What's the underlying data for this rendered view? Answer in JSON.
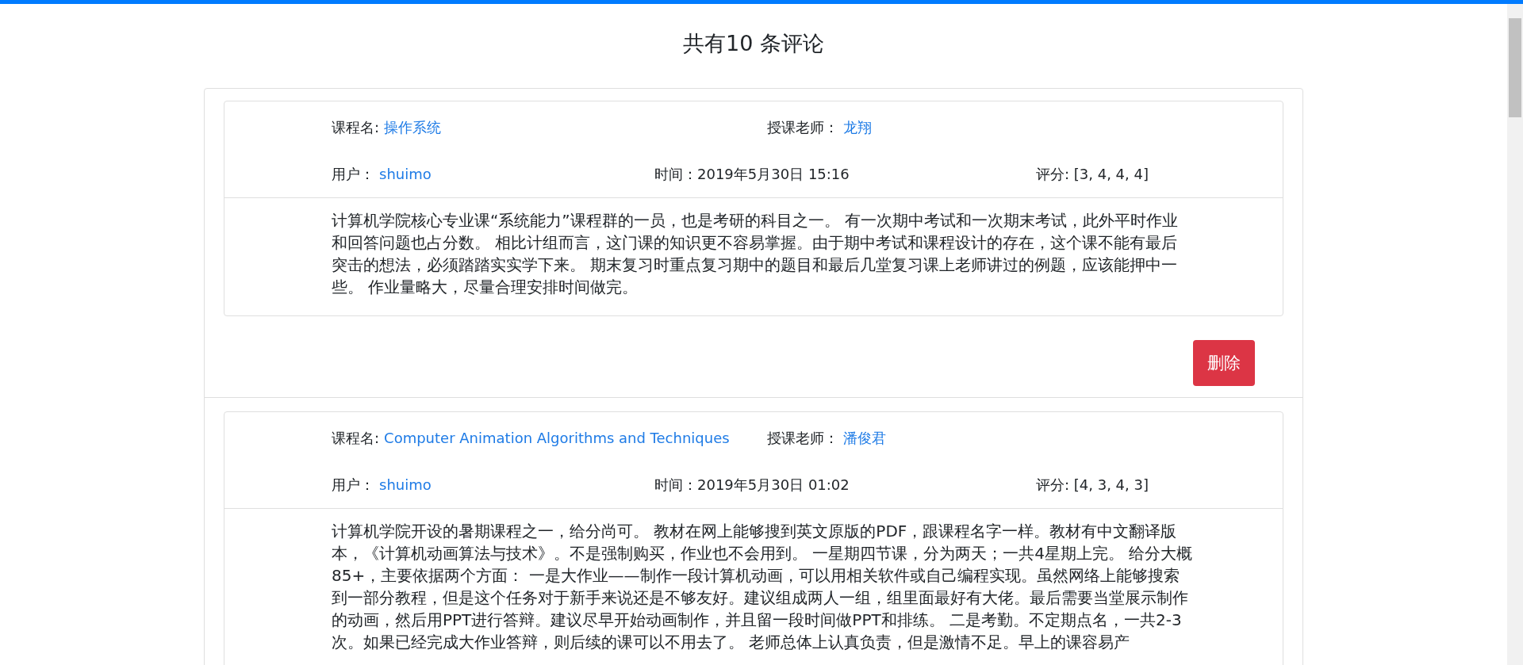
{
  "title": "共有10 条评论",
  "comments": [
    {
      "course_label": "课程名:",
      "course": "操作系统",
      "teacher_label": "授课老师：",
      "teacher": "龙翔",
      "user_label": "用户：",
      "user": "shuimo",
      "time": "时间：2019年5月30日 15:16",
      "score": "评分: [3, 4, 4, 4]",
      "body": "计算机学院核心专业课“系统能力”课程群的一员，也是考研的科目之一。 有一次期中考试和一次期末考试，此外平时作业和回答问题也占分数。 相比计组而言，这门课的知识更不容易掌握。由于期中考试和课程设计的存在，这个课不能有最后突击的想法，必须踏踏实实学下来。 期末复习时重点复习期中的题目和最后几堂复习课上老师讲过的例题，应该能押中一些。 作业量略大，尽量合理安排时间做完。",
      "delete_button": "删除"
    },
    {
      "course_label": "课程名:",
      "course": "Computer Animation Algorithms and Techniques",
      "teacher_label": "授课老师：",
      "teacher": "潘俊君",
      "user_label": "用户：",
      "user": "shuimo",
      "time": "时间：2019年5月30日 01:02",
      "score": "评分: [4, 3, 4, 3]",
      "body": "计算机学院开设的暑期课程之一，给分尚可。 教材在网上能够搜到英文原版的PDF，跟课程名字一样。教材有中文翻译版本，《计算机动画算法与技术》。不是强制购买，作业也不会用到。 一星期四节课，分为两天；一共4星期上完。 给分大概85+，主要依据两个方面： 一是大作业——制作一段计算机动画，可以用相关软件或自己编程实现。虽然网络上能够搜索到一部分教程，但是这个任务对于新手来说还是不够友好。建议组成两人一组，组里面最好有大佬。最后需要当堂展示制作的动画，然后用PPT进行答辩。建议尽早开始动画制作，并且留一段时间做PPT和排练。 二是考勤。不定期点名，一共2-3次。如果已经完成大作业答辩，则后续的课可以不用去了。 老师总体上认真负责，但是激情不足。早上的课容易产"
    }
  ]
}
